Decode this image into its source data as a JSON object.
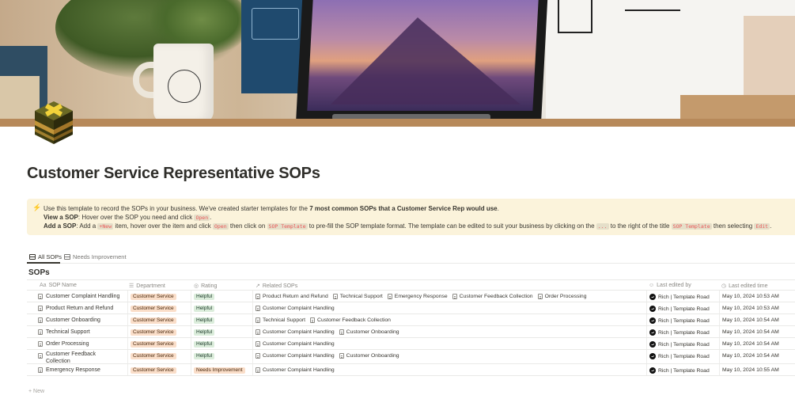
{
  "page": {
    "title": "Customer Service Representative SOPs"
  },
  "callout": {
    "icon": "lightning-bolt-icon",
    "line1_pre": "Use this template to record the SOPs in your business. We've created starter templates for the ",
    "line1_bold": "7 most common SOPs that a Customer Service Rep would use",
    "line1_post": ".",
    "line2_label": "View a SOP",
    "line2_text": ": Hover over the SOP you need and click ",
    "line2_code": "Open",
    "line2_end": ".",
    "line3_label": "Add a SOP",
    "line3_a": ": Add a ",
    "line3_code_new": "+New",
    "line3_b": " item, hover over the item and click ",
    "line3_code_open": "Open",
    "line3_c": " then click on ",
    "line3_code_template": "SOP Template",
    "line3_d": " to pre-fill the SOP template format. The template can be edited to suit your business by clicking on the ",
    "line3_code_dots": "...",
    "line3_e": " to the right of the title ",
    "line3_code_template2": "SOP Template",
    "line3_f": " then selecting ",
    "line3_code_edit": "Edit",
    "line3_g": "."
  },
  "tabs": [
    {
      "label": "All SOPs",
      "active": true
    },
    {
      "label": "Needs Improvement",
      "active": false
    }
  ],
  "database": {
    "title": "SOPs",
    "columns": {
      "name": "SOP Name",
      "department": "Department",
      "rating": "Rating",
      "related": "Related SOPs",
      "edited_by": "Last edited by",
      "edited_time": "Last edited time"
    },
    "rows": [
      {
        "name": "Customer Complaint Handling",
        "department": "Customer Service",
        "rating": "Helpful",
        "related": [
          "Product Return and Refund",
          "Technical Support",
          "Emergency Response",
          "Customer Feedback Collection",
          "Order Processing"
        ],
        "edited_by": "Rich | Template Road",
        "edited_time": "May 10, 2024 10:53 AM"
      },
      {
        "name": "Product Return and Refund",
        "department": "Customer Service",
        "rating": "Helpful",
        "related": [
          "Customer Complaint Handling"
        ],
        "edited_by": "Rich | Template Road",
        "edited_time": "May 10, 2024 10:53 AM"
      },
      {
        "name": "Customer Onboarding",
        "department": "Customer Service",
        "rating": "Helpful",
        "related": [
          "Technical Support",
          "Customer Feedback Collection"
        ],
        "edited_by": "Rich | Template Road",
        "edited_time": "May 10, 2024 10:54 AM"
      },
      {
        "name": "Technical Support",
        "department": "Customer Service",
        "rating": "Helpful",
        "related": [
          "Customer Complaint Handling",
          "Customer Onboarding"
        ],
        "edited_by": "Rich | Template Road",
        "edited_time": "May 10, 2024 10:54 AM"
      },
      {
        "name": "Order Processing",
        "department": "Customer Service",
        "rating": "Helpful",
        "related": [
          "Customer Complaint Handling"
        ],
        "edited_by": "Rich | Template Road",
        "edited_time": "May 10, 2024 10:54 AM"
      },
      {
        "name": "Customer Feedback Collection",
        "department": "Customer Service",
        "rating": "Helpful",
        "related": [
          "Customer Complaint Handling",
          "Customer Onboarding"
        ],
        "edited_by": "Rich | Template Road",
        "edited_time": "May 10, 2024 10:54 AM"
      },
      {
        "name": "Emergency Response",
        "department": "Customer Service",
        "rating": "Needs Improvement",
        "related": [
          "Customer Complaint Handling"
        ],
        "edited_by": "Rich | Template Road",
        "edited_time": "May 10, 2024 10:55 AM"
      }
    ],
    "new_label": "+ New"
  },
  "colors": {
    "callout_bg": "#fbf3db",
    "tag_orange_bg": "#fadec9",
    "tag_green_bg": "#dbeddb",
    "code_red": "#eb5757"
  }
}
